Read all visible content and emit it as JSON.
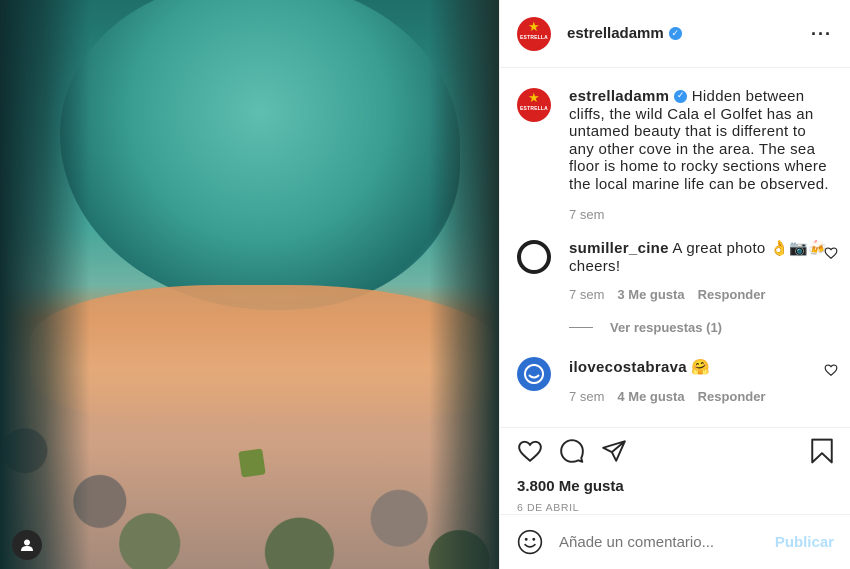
{
  "post": {
    "author": "estrelladamm",
    "logo_text": "ESTRELLA",
    "more_icon": "more-horizontal-icon"
  },
  "caption": {
    "author": "estrelladamm",
    "text": "Hidden between cliffs, the wild Cala el Golfet has an untamed beauty that is different to any other cove in the area. The sea floor is home to rocky sections where the local marine life can be observed.",
    "time": "7 sem"
  },
  "comments": [
    {
      "author": "sumiller_cine",
      "text": "A great photo 👌📷🍻 cheers!",
      "time": "7 sem",
      "likes": "3 Me gusta",
      "reply": "Responder",
      "view_replies": "Ver respuestas (1)"
    },
    {
      "author": "ilovecostabrava",
      "text": "🤗",
      "time": "7 sem",
      "likes": "4 Me gusta",
      "reply": "Responder"
    }
  ],
  "actions": {
    "likes": "3.800 Me gusta",
    "date": "6 DE ABRIL"
  },
  "add_comment": {
    "placeholder": "Añade un comentario...",
    "publish": "Publicar"
  },
  "colors": {
    "verified": "#3897f0",
    "brand_red": "#d8201f",
    "publish_disabled": "#b2dffc"
  }
}
